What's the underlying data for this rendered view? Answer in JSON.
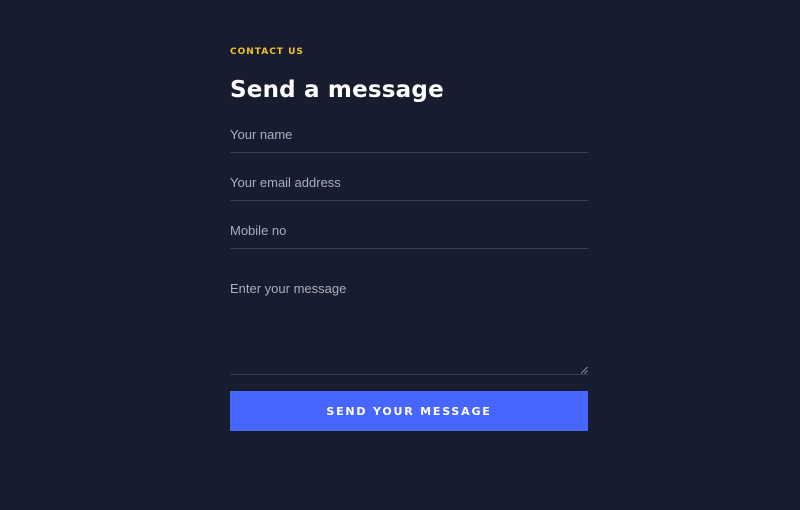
{
  "form": {
    "eyebrow": "CONTACT US",
    "title": "Send a message",
    "fields": {
      "name": {
        "placeholder": "Your name",
        "value": ""
      },
      "email": {
        "placeholder": "Your email address",
        "value": ""
      },
      "mobile": {
        "placeholder": "Mobile no",
        "value": ""
      },
      "message": {
        "placeholder": "Enter your message",
        "value": ""
      }
    },
    "submit_label": "SEND YOUR MESSAGE"
  },
  "colors": {
    "background": "#181c2f",
    "accent": "#f2c12e",
    "button": "#4766ff",
    "divider": "#383d53"
  },
  "icons": {
    "textarea_resize": "resize-handle-icon"
  }
}
